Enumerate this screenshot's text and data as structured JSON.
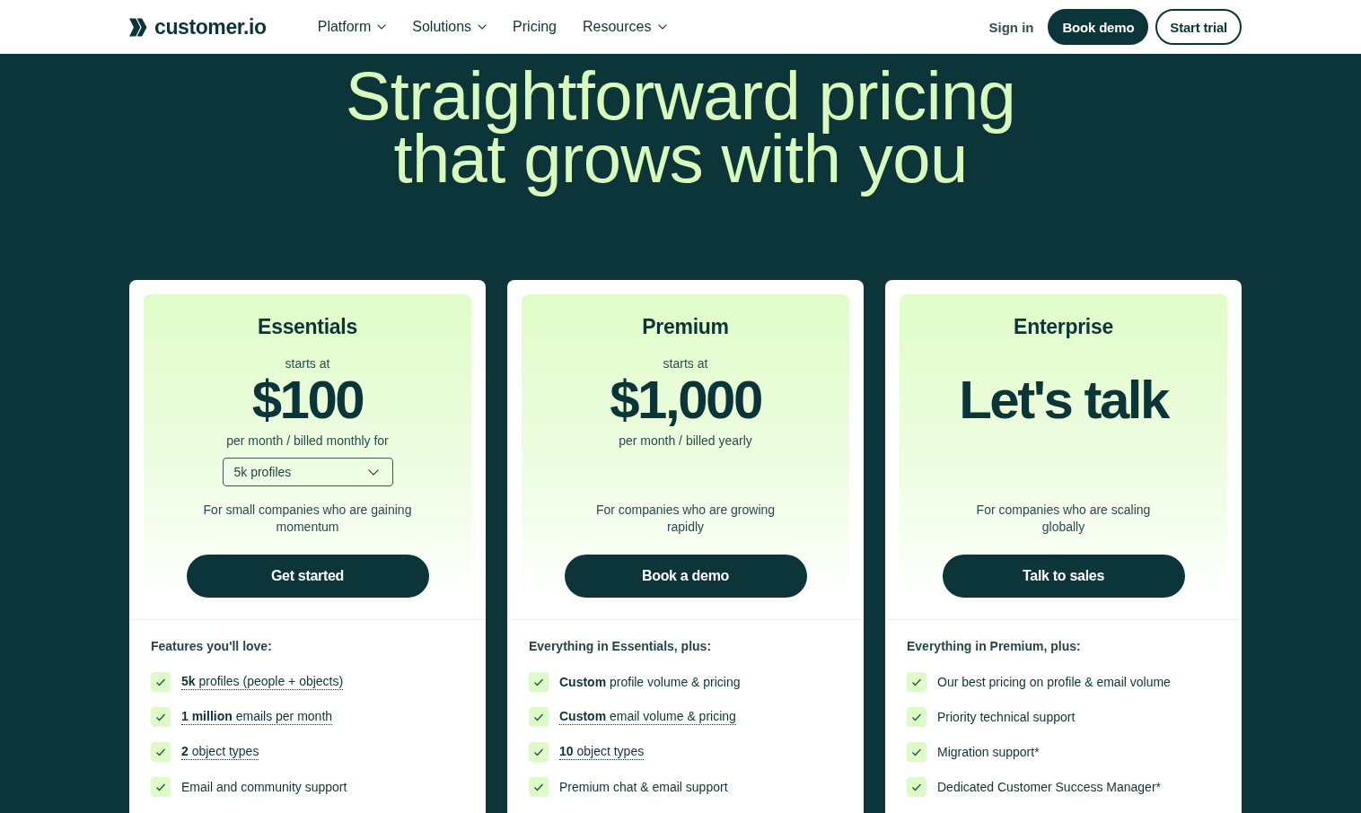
{
  "nav": {
    "logo": "customer.io",
    "links": [
      {
        "label": "Platform",
        "dropdown": true
      },
      {
        "label": "Solutions",
        "dropdown": true
      },
      {
        "label": "Pricing",
        "dropdown": false
      },
      {
        "label": "Resources",
        "dropdown": true
      }
    ],
    "sign_in": "Sign in",
    "buttons": [
      {
        "label": "Book demo",
        "kind": "filled"
      },
      {
        "label": "Start trial",
        "kind": "outline"
      }
    ]
  },
  "hero": {
    "title": "Straightforward pricing that grows with you"
  },
  "plans": [
    {
      "name": "Essentials",
      "kicker": "starts at",
      "price": "$100",
      "billing": "per month / billed monthly for",
      "profile_select": {
        "value": "5k profiles"
      },
      "description": "For small companies who are gaining momentum",
      "button": "Get started",
      "features_heading": "Features you'll love:",
      "features": [
        {
          "text": "**5k** profiles (people + objects)",
          "underlined": true
        },
        {
          "text": "**1 million** emails per month",
          "underlined": true
        },
        {
          "text": "**2** object types",
          "underlined": true
        },
        {
          "text": "Email and community support",
          "underlined": false
        }
      ]
    },
    {
      "name": "Premium",
      "kicker": "starts at",
      "price": "$1,000",
      "billing": "per month / billed yearly",
      "description": "For companies who are growing rapidly",
      "button": "Book a demo",
      "features_heading": "Everything in Essentials, plus:",
      "features": [
        {
          "text": "**Custom** profile volume & pricing",
          "underlined": false
        },
        {
          "text": "**Custom** email volume & pricing",
          "underlined": true
        },
        {
          "text": "**10** object types",
          "underlined": true
        },
        {
          "text": "Premium chat & email support",
          "underlined": false
        }
      ]
    },
    {
      "name": "Enterprise",
      "price": "Let's talk",
      "description": "For companies who are scaling globally",
      "button": "Talk to sales",
      "features_heading": "Everything in Premium, plus:",
      "features": [
        {
          "text": "Our best pricing on profile & email volume",
          "underlined": false
        },
        {
          "text": "Priority technical support",
          "underlined": false
        },
        {
          "text": "Migration support*",
          "underlined": false
        },
        {
          "text": "Dedicated Customer Success Manager*",
          "underlined": false
        }
      ]
    }
  ]
}
